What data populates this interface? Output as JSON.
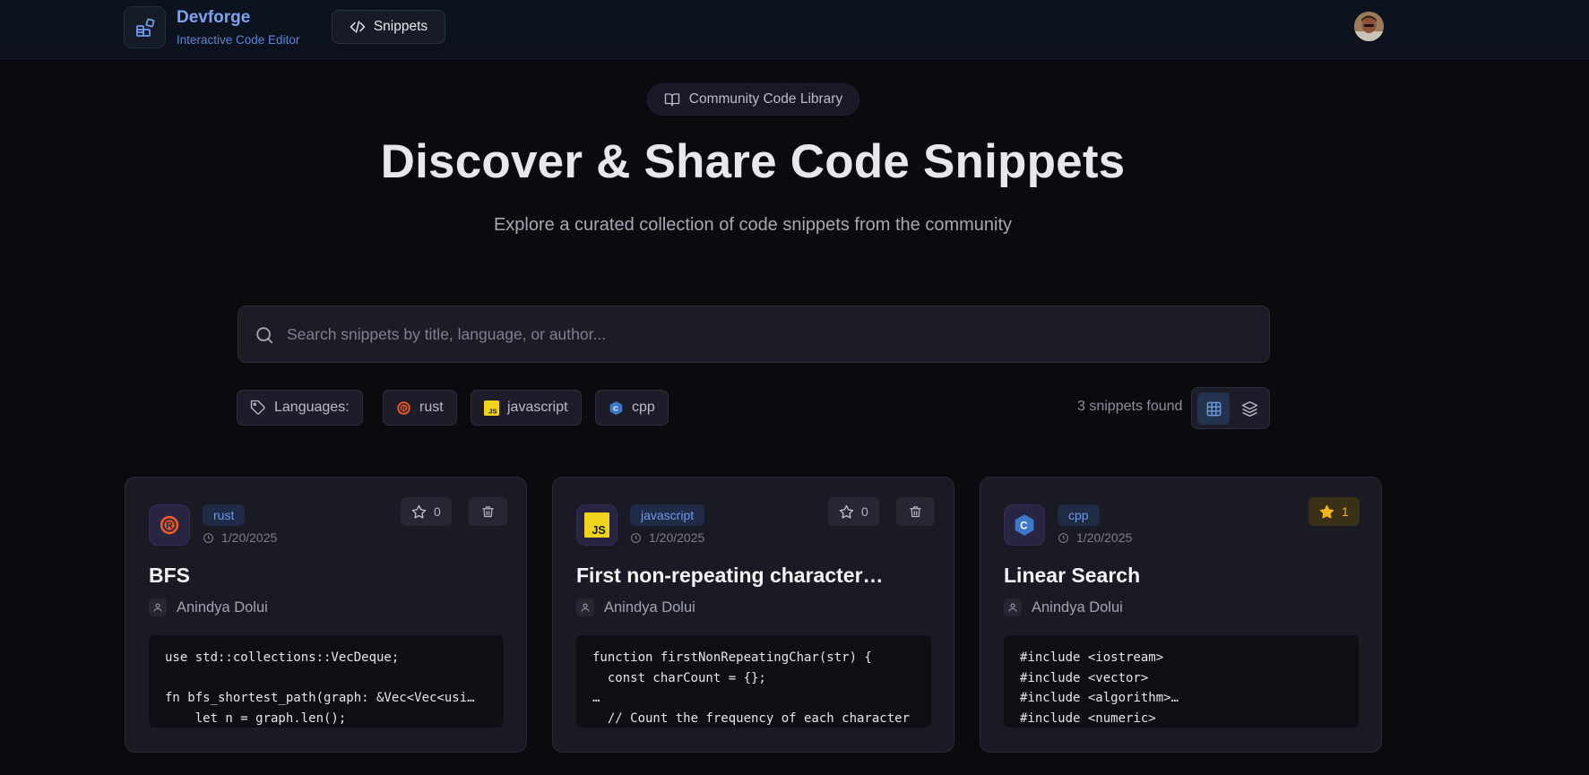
{
  "header": {
    "brand_name": "Devforge",
    "brand_subtitle": "Interactive Code Editor",
    "nav_snippets_label": "Snippets",
    "accent_color": "#7aa4f0"
  },
  "hero": {
    "pill_label": "Community Code Library",
    "title": "Discover & Share Code Snippets",
    "subtitle": "Explore a curated collection of code snippets from the community"
  },
  "search": {
    "placeholder": "Search snippets by title, language, or author...",
    "value": ""
  },
  "filters": {
    "languages_label": "Languages:",
    "languages": [
      {
        "label": "rust",
        "icon": "rust-icon"
      },
      {
        "label": "javascript",
        "icon": "javascript-icon"
      },
      {
        "label": "cpp",
        "icon": "cpp-icon"
      }
    ],
    "count_text": "3 snippets found",
    "active_view": "grid"
  },
  "snippets": [
    {
      "language": "rust",
      "date": "1/20/2025",
      "stars": "0",
      "starred": false,
      "title": "BFS",
      "author": "Anindya Dolui",
      "code": "use std::collections::VecDeque;\n\nfn bfs_shortest_path(graph: &Vec<Vec<usi…\n    let n = graph.len();"
    },
    {
      "language": "javascript",
      "date": "1/20/2025",
      "stars": "0",
      "starred": false,
      "title": "First non-repeating character…",
      "author": "Anindya Dolui",
      "code": "function firstNonRepeatingChar(str) {\n  const charCount = {};\n…\n  // Count the frequency of each character"
    },
    {
      "language": "cpp",
      "date": "1/20/2025",
      "stars": "1",
      "starred": true,
      "title": "Linear Search",
      "author": "Anindya Dolui",
      "code": "#include <iostream>\n#include <vector>\n#include <algorithm>…\n#include <numeric>"
    }
  ]
}
